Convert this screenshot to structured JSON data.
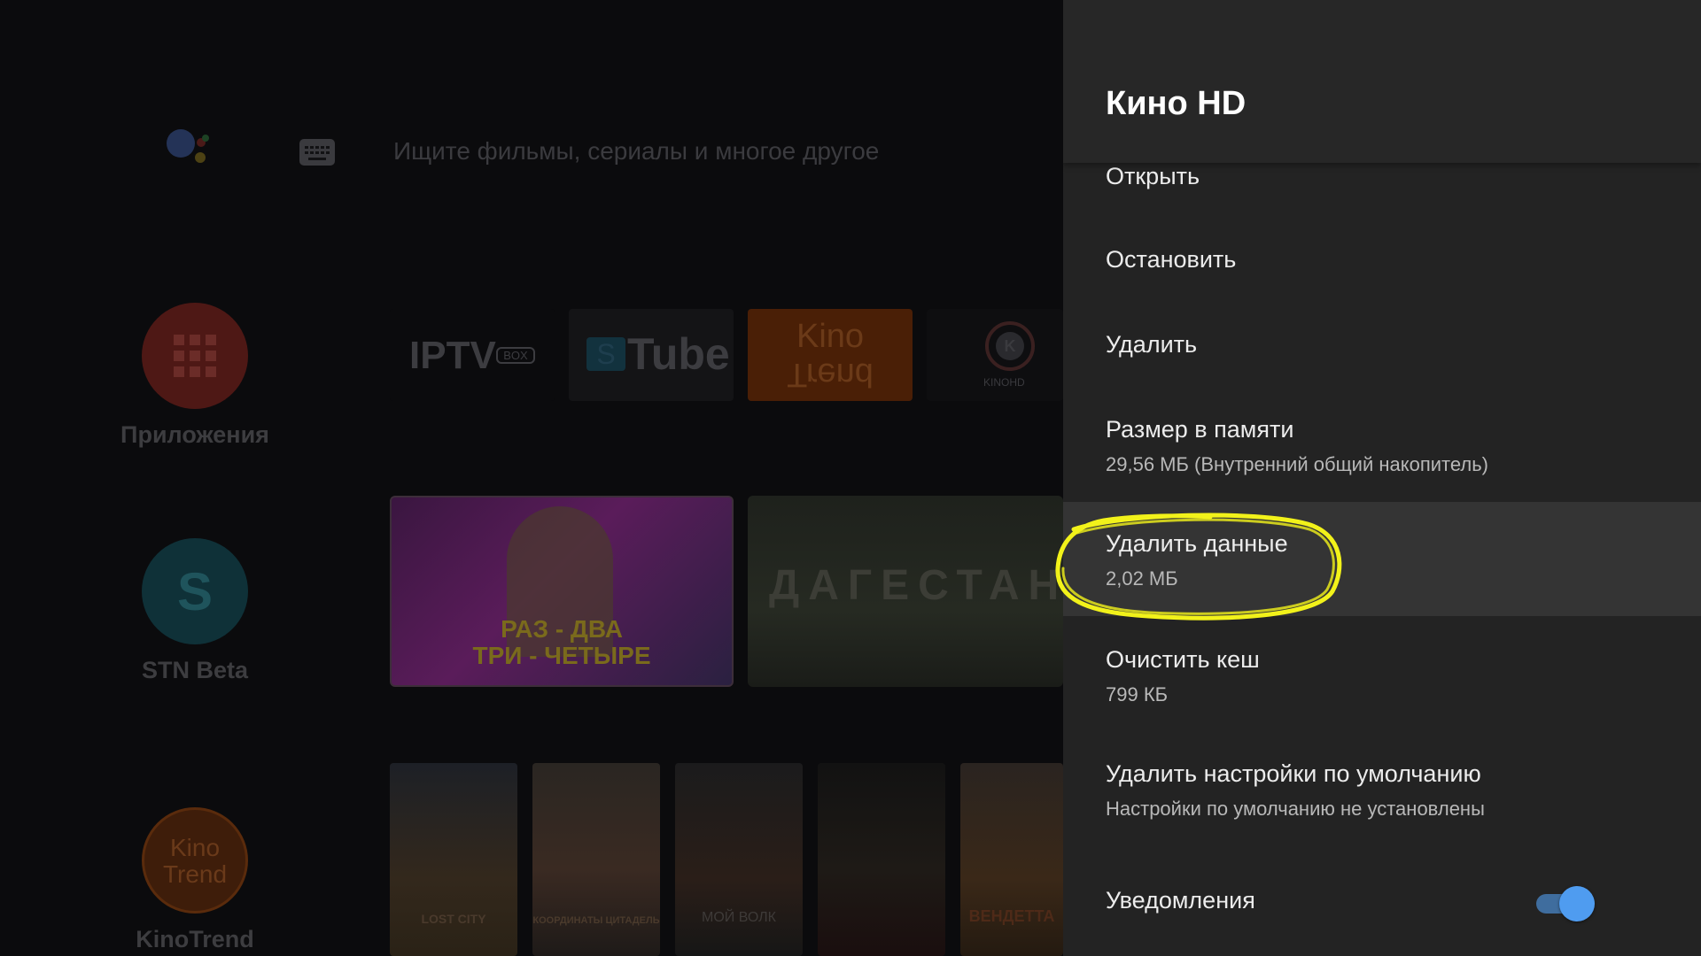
{
  "launcher": {
    "search_hint": "Ищите фильмы, сериалы и многое другое",
    "apps": [
      {
        "label": "Приложения",
        "color": "#5a1a17"
      },
      {
        "label": "STN Beta",
        "color": "#0f3a44",
        "glyph": "S"
      },
      {
        "label": "KinoTrend",
        "color": "#5a2608",
        "glyph": "Kino\nTrend"
      }
    ],
    "favorites": [
      {
        "text": "IPTV",
        "sub": "BOX"
      },
      {
        "text": "Tube",
        "sub": "S"
      },
      {
        "text": "Kino",
        "sub": "Trend"
      },
      {
        "text": "KINOHD",
        "sub": "K"
      }
    ],
    "banners": [
      {
        "text": "РАЗ - ДВА\nТРИ - ЧЕТЫРЕ"
      },
      {
        "text": "ДАГЕСТАН"
      }
    ],
    "posters": [
      {
        "text": "LOST CITY"
      },
      {
        "text": "КООРДИНАТЫ ЦИТАДЕЛЬ"
      },
      {
        "text": "МОЙ ВОЛК"
      },
      {
        "text": ""
      },
      {
        "text": "ВЕНДЕТТА"
      }
    ]
  },
  "panel": {
    "title": "Кино HD",
    "items": [
      {
        "title": "Открыть",
        "subtitle": ""
      },
      {
        "title": "Остановить",
        "subtitle": ""
      },
      {
        "title": "Удалить",
        "subtitle": ""
      },
      {
        "title": "Размер в памяти",
        "subtitle": "29,56 МБ (Внутренний общий накопитель)"
      },
      {
        "title": "Удалить данные",
        "subtitle": "2,02 МБ"
      },
      {
        "title": "Очистить кеш",
        "subtitle": "799 КБ"
      },
      {
        "title": "Удалить настройки по умолчанию",
        "subtitle": "Настройки по умолчанию не установлены"
      },
      {
        "title": "Уведомления",
        "subtitle": ""
      }
    ],
    "notifications_enabled": true,
    "colors": {
      "toggle_on": "#4f9cf0",
      "highlight_annotation": "#f2f21a"
    }
  }
}
